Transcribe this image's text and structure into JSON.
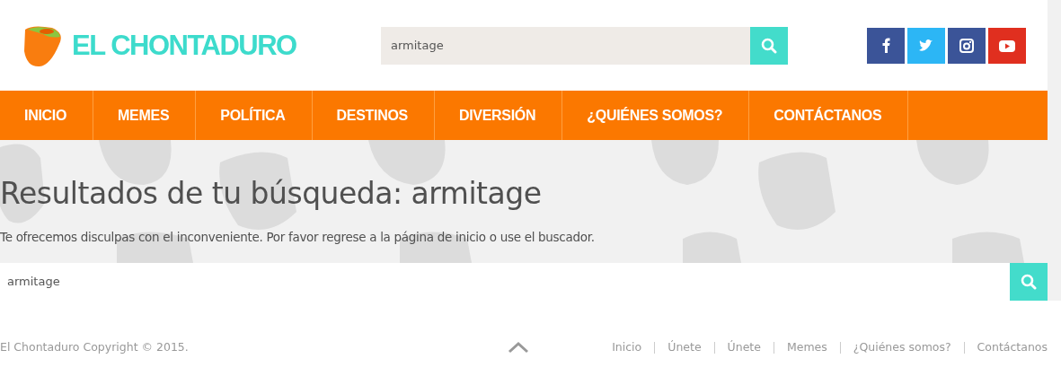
{
  "header": {
    "logo_text": "EL CHONTADURO",
    "search": {
      "value": "armitage"
    },
    "social": [
      {
        "kind": "facebook",
        "color": "#3b5498"
      },
      {
        "kind": "twitter",
        "color": "#2cb6f5"
      },
      {
        "kind": "instagram",
        "color": "#3b5498"
      },
      {
        "kind": "youtube",
        "color": "#e02f1f"
      }
    ]
  },
  "nav": {
    "items": [
      "INICIO",
      "MEMES",
      "POLÍTICA",
      "DESTINOS",
      "DIVERSIÓN",
      "¿QUIÉNES SOMOS?",
      "CONTÁCTANOS"
    ]
  },
  "results": {
    "title": "Resultados de tu búsqueda: armitage",
    "message": "Te ofrecemos disculpas con el inconveniente. Por favor regrese a la página de inicio o use el buscador.",
    "search": {
      "value": "armitage"
    }
  },
  "footer": {
    "copyright": "El Chontaduro Copyright © 2015.",
    "links": [
      "Inicio",
      "Únete",
      "Únete",
      "Memes",
      "¿Quiénes somos?",
      "Contáctanos"
    ]
  }
}
